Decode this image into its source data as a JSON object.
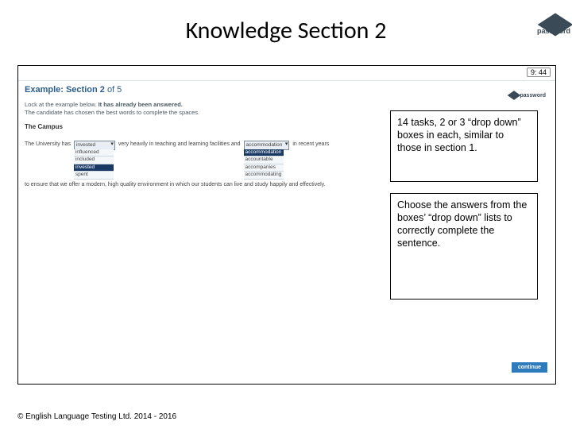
{
  "title": "Knowledge Section 2",
  "logo_word": "password",
  "frame": {
    "timer": "9: 44",
    "section_heading_pre": "Example: Section ",
    "section_num": "2",
    "section_heading_post": " of 5",
    "instr_line1_a": "Lock at the example below. ",
    "instr_line1_b": "It has already been answered.",
    "instr_line2": "The candidate has chosen the best words to complete the spaces.",
    "mini_logo": "password",
    "task_title": "The Campus",
    "sent_a": "The University has",
    "dd1": {
      "selected": "invested",
      "opts": [
        "influenced",
        "included",
        "invested",
        "spent"
      ]
    },
    "sent_b": "very heavily in teaching and learning facilities and",
    "dd2": {
      "selected": "accommodation",
      "opts": [
        "accommodation",
        "accountable",
        "accompanies",
        "accommodating"
      ]
    },
    "sent_c": "in recent years",
    "sent2": "to ensure that we offer a modern, high quality environment in which our students can live and study happily and effectively.",
    "continue": "continue"
  },
  "callout1": "14 tasks, 2 or 3 “drop down” boxes in each, similar to those in section 1.",
  "callout2": "Choose the answers from the boxes’ “drop down” lists to correctly complete the sentence.",
  "footer": "© English Language Testing Ltd. 2014 - 2016"
}
